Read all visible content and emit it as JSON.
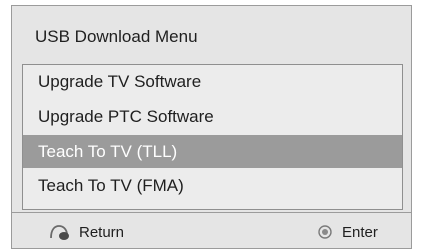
{
  "menu": {
    "title": "USB Download Menu",
    "items": [
      {
        "label": "Upgrade TV Software",
        "selected": false
      },
      {
        "label": "Upgrade PTC Software",
        "selected": false
      },
      {
        "label": "Teach To TV (TLL)",
        "selected": true
      },
      {
        "label": "Teach To TV (FMA)",
        "selected": false
      }
    ]
  },
  "footer": {
    "return_label": "Return",
    "return_icon": "return-icon",
    "enter_label": "Enter",
    "enter_icon": "enter-icon"
  },
  "colors": {
    "panel_bg": "#e5e5e5",
    "selected_bg": "#9b9b9b",
    "selected_text": "#ffffff",
    "text": "#1f1f1f"
  }
}
